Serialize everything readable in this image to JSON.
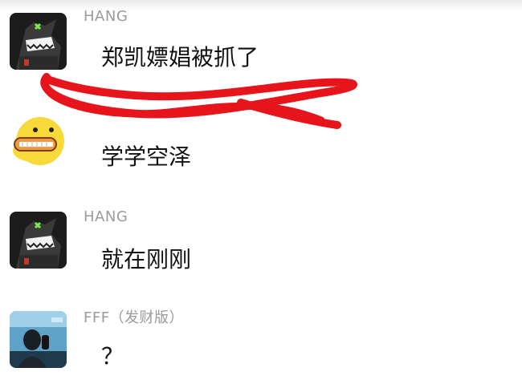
{
  "messages": [
    {
      "sender": "HANG",
      "text": "郑凯嫖娼被抓了",
      "avatar": "shark-avatar-icon"
    },
    {
      "sender": "",
      "text": "学学空泽",
      "avatar": "yellow-duck-avatar-icon"
    },
    {
      "sender": "HANG",
      "text": "就在刚刚",
      "avatar": "shark-avatar-icon"
    },
    {
      "sender": "FFF（发财版）",
      "text": "？",
      "avatar": "photo-person-avatar-icon"
    }
  ],
  "scribble_color": "#e8141c"
}
